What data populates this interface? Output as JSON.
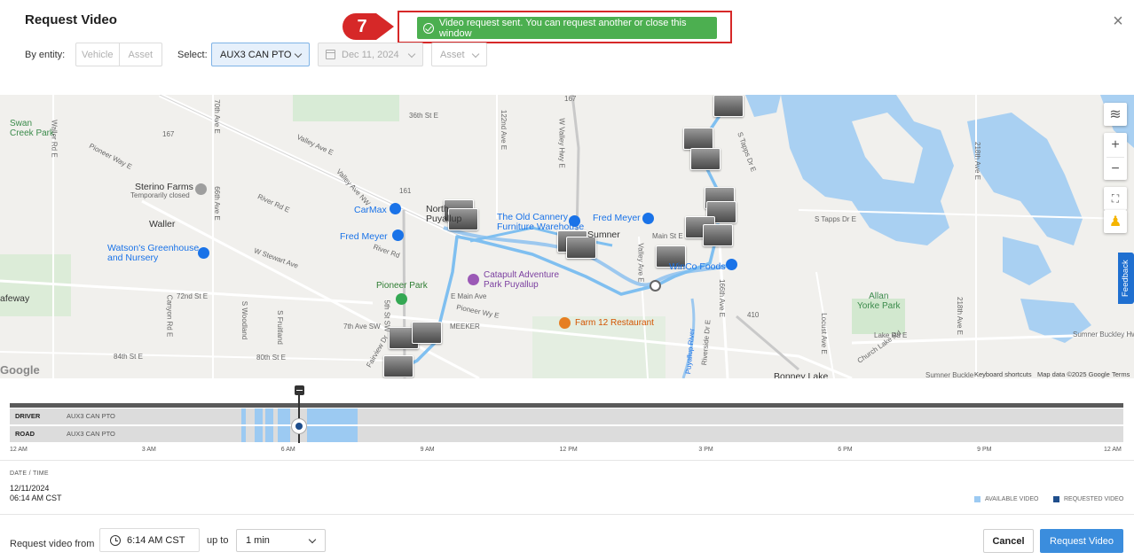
{
  "dialog": {
    "title": "Request Video",
    "close_icon": "close-icon",
    "step_number": "7",
    "toast_message": "Video request sent. You can request another or close this window",
    "colors": {
      "toast": "#4caf50",
      "highlight": "#d62828",
      "primary": "#3b8ddd",
      "available_video": "#9ccaf2",
      "requested_video": "#1f4e8c"
    }
  },
  "filters": {
    "by_entity_label": "By entity:",
    "entity_options": [
      "Vehicle",
      "Asset"
    ],
    "select_label": "Select:",
    "selected_entity": "AUX3 CAN PTO",
    "date": "Dec 11, 2024",
    "asset": "Asset"
  },
  "map": {
    "labels": {
      "swan_creek_park": "Swan\nCreek Park",
      "pioneer_way_e": "Pioneer Way E",
      "valley_ave_e": "Valley Ave E",
      "st_36th": "36th St E",
      "ave_122nd": "122nd Ave E",
      "w_valley_hwy_e": "W Valley Hwy E",
      "s_tapps_dr_e": "S Tapps Dr E",
      "ave_218th": "218th Ave E",
      "sterino_farms": "Sterino Farms",
      "temporarily_closed": "Temporarily closed",
      "waller_rd_e": "Waller Rd E",
      "ave_66th": "66th Ave E",
      "ave_70th": "70th Ave E",
      "valley_ave_nw": "Valley Ave NW",
      "river_rd_e": "River Rd E",
      "carmax": "CarMax",
      "north_puyallup": "North\nPuyallup",
      "old_cannery": "The Old Cannery\nFurniture Warehouse",
      "fred_meyer_1": "Fred Meyer",
      "fred_meyer_2": "Fred Meyer",
      "waller": "Waller",
      "watsons": "Watson's Greenhouse\nand Nursery",
      "w_stewart_ave": "W Stewart Ave",
      "river_rd": "River Rd",
      "sumner": "Sumner",
      "main_st_e": "Main St E",
      "s_tapps_dr_e_2": "S Tapps Dr E",
      "winco_foods": "WinCo Foods",
      "catapult": "Catapult Adventure\nPark Puyallup",
      "pioneer_park": "Pioneer Park",
      "e_main_ave": "E Main Ave",
      "pioneer_way_e_2": "Pioneer Wy E",
      "farm_12": "Farm 12 Restaurant",
      "allan_yorke_park": "Allan\nYorke Park",
      "st_72nd": "72nd St E",
      "st_80th": "80th St E",
      "st_84th": "84th St E",
      "st_7th": "7th Ave SW",
      "meeker": "MEEKER",
      "fairview_dr": "Fairview Dr",
      "riverside_dr": "Riverside Dr E",
      "puyallup_river": "Puyallup River",
      "canyon_rd_e": "Canyon Rd E",
      "woodland_s": "S Woodland",
      "fruitland_s": "S Fruitland",
      "bonney_lake": "Bonney Lake",
      "sumner_buckley_hwy": "Sumner Buckley Hwy",
      "sumner_buckley_hwy_2": "Sumner Buckle",
      "lake_rd_e": "Lake Rd E",
      "locust_ave_e": "Locust Ave E",
      "church_lake_rd": "Church Lake Rd",
      "ave_166th": "166th Ave E",
      "ave_5th": "5th St SW",
      "ave_218th_2": "218th Ave E",
      "hwy_ave_e": "Valley Ave E",
      "freeway": "afeway",
      "route_167": "167",
      "route_161": "161",
      "route_410": "410"
    },
    "keyboard_shortcuts": "Keyboard shortcuts",
    "map_data": "Map data ©2025 Google",
    "terms": "Terms",
    "google": "Google",
    "feedback": "Feedback",
    "controls": {
      "layers_icon": "layers-icon",
      "zoom_in": "+",
      "zoom_out": "−",
      "fullscreen_icon": "fullscreen-icon",
      "pegman_icon": "pegman-icon"
    }
  },
  "timeline": {
    "rows": [
      {
        "label": "DRIVER",
        "entity": "AUX3 CAN PTO"
      },
      {
        "label": "ROAD",
        "entity": "AUX3 CAN PTO"
      }
    ],
    "available_segments_hours": [
      [
        5.0,
        5.08
      ],
      [
        5.28,
        5.45
      ],
      [
        5.5,
        5.68
      ],
      [
        5.78,
        6.05
      ],
      [
        6.4,
        7.5
      ]
    ],
    "cursor_hour": 6.233,
    "ticks": [
      "12 AM",
      "3 AM",
      "6 AM",
      "9 AM",
      "12 PM",
      "3 PM",
      "6 PM",
      "9 PM",
      "12 AM"
    ],
    "date_time_label": "DATE / TIME",
    "date_value": "12/11/2024",
    "time_value": "06:14 AM CST",
    "legend": {
      "available": "AVAILABLE VIDEO",
      "requested": "REQUESTED VIDEO"
    }
  },
  "footer": {
    "request_from_label": "Request video from",
    "time_value": "6:14 AM CST",
    "up_to_label": "up to",
    "duration_value": "1 min",
    "cancel_label": "Cancel",
    "request_label": "Request Video"
  }
}
